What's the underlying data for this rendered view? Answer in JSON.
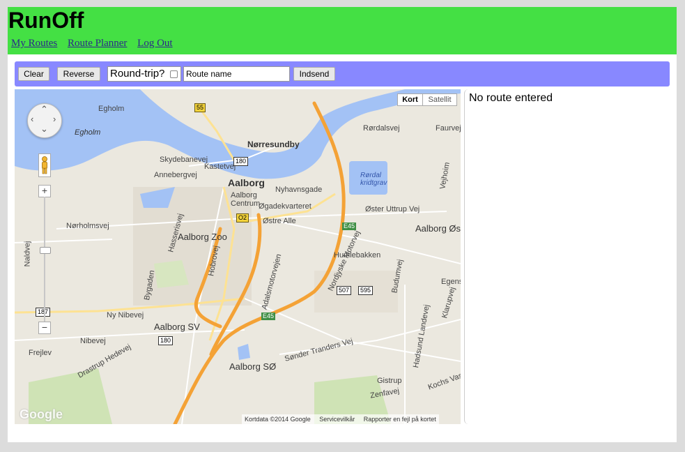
{
  "app": {
    "title": "RunOff"
  },
  "nav": {
    "my_routes": "My Routes",
    "route_planner": "Route Planner",
    "log_out": "Log Out"
  },
  "toolbar": {
    "clear": "Clear",
    "reverse": "Reverse",
    "round_trip": "Round-trip?",
    "round_trip_checked": false,
    "route_name_value": "Route name",
    "submit": "Indsend"
  },
  "map": {
    "type_map": "Kort",
    "type_satellite": "Satellit",
    "attribution": {
      "data": "Kortdata ©2014 Google",
      "terms": "Servicevilkår",
      "report": "Rapporter en fejl på kortet"
    },
    "logo": "Google",
    "zoom_in": "+",
    "zoom_out": "−",
    "labels": {
      "egholm_road": "Egholm",
      "egholm": "Egholm",
      "norresundby": "Nørresundby",
      "aalborg": "Aalborg",
      "aalborg_centrum": "Aalborg Centrum",
      "nyhavnsgade": "Nyhavnsgade",
      "ogadekvarteret": "Øgadekvarteret",
      "ostre_alle": "Østre Alle",
      "aalborg_zoo": "Aalborg Zoo",
      "norholmsvej": "Nørholmsvej",
      "hasserisvej": "Hasserisvej",
      "hobrovej": "Hobrovej",
      "bygaden": "Bygaden",
      "ny_nibevej": "Ny Nibevej",
      "aalborg_sv": "Aalborg SV",
      "nibevej": "Nibevej",
      "frejlev": "Frejlev",
      "drastrup_hedevej": "Drastrup Hedevej",
      "aalborg_so": "Aalborg SØ",
      "sonder_tranders_vej": "Sønder Tranders Vej",
      "gistrup": "Gistrup",
      "zenfavej": "Zenfavej",
      "kochs_vase": "Kochs Vase",
      "hadsund_landevej": "Hadsund Landevej",
      "humlebakken": "Humlebakken",
      "budumvej": "Budumvej",
      "klarupvej": "Klarupvej",
      "egense": "Egense",
      "aalborg_ost": "Aalborg Øst",
      "oster_uttrup_vej": "Øster Uttrup Vej",
      "vejhoim": "Vejhoim",
      "rordal_kridtgrav": "Rørdal kridtgrav",
      "rordalsvej": "Rørdalsvej",
      "faurvej": "Faurvej",
      "nordjyske_motorvej": "Nordjyske Motorvej",
      "adelmotorvejen": "Adalsmotorvejen",
      "skydebanevej": "Skydebanevej",
      "annebergvej": "Annebergvej",
      "kastetvej": "Kastetvej",
      "naldevej": "Naldvej"
    },
    "shields": {
      "s55": "55",
      "s180a": "180",
      "s180b": "180",
      "s187": "187",
      "s507": "507",
      "s595": "595",
      "o2": "O2",
      "e45a": "E45",
      "e45b": "E45"
    }
  },
  "panel": {
    "status": "No route entered"
  },
  "colors": {
    "header": "#44e044",
    "toolbar": "#8888ff",
    "water": "#a3c2f5",
    "motorway": "#f4a236",
    "road": "#fde293"
  }
}
